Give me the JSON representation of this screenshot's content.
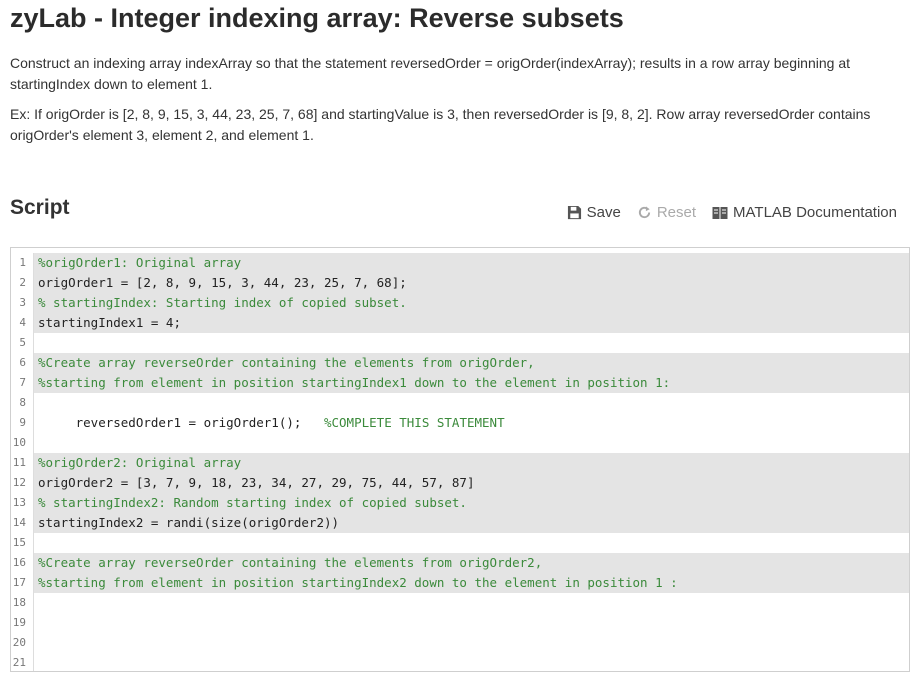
{
  "page": {
    "title": "zyLab - Integer indexing array: Reverse subsets",
    "description_1": "Construct an indexing array indexArray so that the statement reversedOrder = origOrder(indexArray); results in a row array beginning at startingIndex down to element 1.",
    "description_2": "Ex: If origOrder is [2, 8, 9, 15, 3, 44, 23, 25, 7, 68] and startingValue is 3, then reversedOrder is [9, 8, 2]. Row array reversedOrder contains origOrder's element 3, element 2, and element 1."
  },
  "script": {
    "heading": "Script",
    "toolbar": {
      "save_label": "Save",
      "reset_label": "Reset",
      "docs_label": "MATLAB Documentation"
    },
    "lines": [
      {
        "num": "1",
        "locked": true,
        "parts": [
          {
            "t": "%origOrder1: Original array",
            "c": "comment"
          }
        ]
      },
      {
        "num": "2",
        "locked": true,
        "parts": [
          {
            "t": "origOrder1 = [2, 8, 9, 15, 3, 44, 23, 25, 7, 68];",
            "c": "plain"
          }
        ]
      },
      {
        "num": "3",
        "locked": true,
        "parts": [
          {
            "t": "% startingIndex: Starting index of copied subset.",
            "c": "comment"
          }
        ]
      },
      {
        "num": "4",
        "locked": true,
        "parts": [
          {
            "t": "startingIndex1 = 4;",
            "c": "plain"
          }
        ]
      },
      {
        "num": "5",
        "locked": false,
        "parts": []
      },
      {
        "num": "6",
        "locked": true,
        "parts": [
          {
            "t": "%Create array reverseOrder containing the elements from origOrder,",
            "c": "comment"
          }
        ]
      },
      {
        "num": "7",
        "locked": true,
        "parts": [
          {
            "t": "%starting from element in position startingIndex1 down to the element in position 1:",
            "c": "comment"
          }
        ]
      },
      {
        "num": "8",
        "locked": false,
        "parts": []
      },
      {
        "num": "9",
        "locked": false,
        "parts": [
          {
            "t": "     reversedOrder1 = origOrder1();   ",
            "c": "plain"
          },
          {
            "t": "%COMPLETE THIS STATEMENT",
            "c": "comment"
          }
        ]
      },
      {
        "num": "10",
        "locked": false,
        "parts": []
      },
      {
        "num": "11",
        "locked": true,
        "parts": [
          {
            "t": "%origOrder2: Original array",
            "c": "comment"
          }
        ]
      },
      {
        "num": "12",
        "locked": true,
        "parts": [
          {
            "t": "origOrder2 = [3, 7, 9, 18, 23, 34, 27, 29, 75, 44, 57, 87]",
            "c": "plain"
          }
        ]
      },
      {
        "num": "13",
        "locked": true,
        "parts": [
          {
            "t": "% startingIndex2: Random starting index of copied subset.",
            "c": "comment"
          }
        ]
      },
      {
        "num": "14",
        "locked": true,
        "parts": [
          {
            "t": "startingIndex2 = randi(size(origOrder2))",
            "c": "plain"
          }
        ]
      },
      {
        "num": "15",
        "locked": false,
        "parts": []
      },
      {
        "num": "16",
        "locked": true,
        "parts": [
          {
            "t": "%Create array reverseOrder containing the elements from origOrder2,",
            "c": "comment"
          }
        ]
      },
      {
        "num": "17",
        "locked": true,
        "parts": [
          {
            "t": "%starting from element in position startingIndex2 down to the element in position 1 :",
            "c": "comment"
          }
        ]
      },
      {
        "num": "18",
        "locked": false,
        "parts": []
      },
      {
        "num": "19",
        "locked": false,
        "parts": []
      },
      {
        "num": "20",
        "locked": false,
        "parts": []
      },
      {
        "num": "21",
        "locked": false,
        "parts": []
      }
    ]
  },
  "icons": {
    "save": "floppy-disk-icon",
    "reset": "refresh-icon",
    "docs": "book-icon"
  },
  "colors": {
    "comment": "#3b8a3b",
    "locked_line_bg": "#e4e4e4",
    "disabled": "#aaaaaa"
  }
}
